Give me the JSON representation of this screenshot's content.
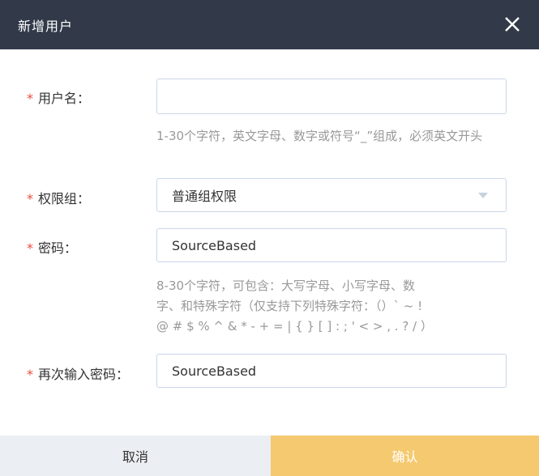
{
  "dialog": {
    "title": "新增用户",
    "close_icon": "close-icon"
  },
  "form": {
    "required_mark": "*",
    "username": {
      "label": "用户名：",
      "value": "",
      "placeholder": "",
      "hint": "1-30个字符，英文字母、数字或符号“_”组成，必须英文开头"
    },
    "group": {
      "label": "权限组：",
      "selected": "普通组权限",
      "icon": "caret-down-icon"
    },
    "password": {
      "label": "密码：",
      "value": "SourceBased",
      "hint_line1": "8-30个字符，可包含：大写字母、小写字母、数",
      "hint_line2": "字、和特殊字符（仅支持下列特殊字符：（）` ~ !",
      "hint_line3": "@ # $ % ^ & * - + = | { } [ ] : ; ' < > , . ? / ）"
    },
    "confirm_password": {
      "label": "再次输入密码：",
      "value": "SourceBased"
    }
  },
  "footer": {
    "cancel_label": "取消",
    "confirm_label": "确认"
  },
  "colors": {
    "header_bg": "#323a4a",
    "required": "#e84c3d",
    "confirm_bg": "#f5c96f",
    "cancel_bg": "#ebeef3"
  }
}
